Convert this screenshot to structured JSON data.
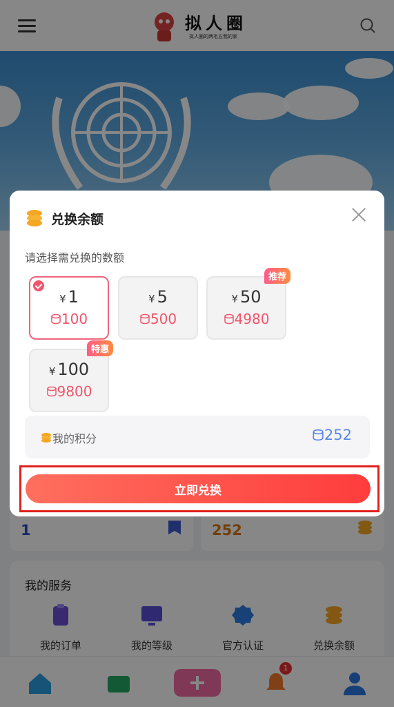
{
  "header": {
    "app_title": "拟人圈",
    "slogan": "拟人圈的两毛五我的家"
  },
  "modal": {
    "title": "兑换余额",
    "hint": "请选择需兑换的数额",
    "options": [
      {
        "price": "1",
        "points": "100",
        "tag": "",
        "selected": true
      },
      {
        "price": "5",
        "points": "500",
        "tag": ""
      },
      {
        "price": "50",
        "points": "4980",
        "tag": "推荐"
      },
      {
        "price": "100",
        "points": "9800",
        "tag": "特惠"
      }
    ],
    "currency_symbol": "¥",
    "my_points_label": "我的积分",
    "my_points_value": "252",
    "exchange_button": "立即兑换"
  },
  "stats": {
    "balance": "1",
    "points": "252"
  },
  "services": {
    "title": "我的服务",
    "items": [
      {
        "label": "我的订单",
        "icon": "clipboard-icon"
      },
      {
        "label": "我的等级",
        "icon": "chart-icon"
      },
      {
        "label": "官方认证",
        "icon": "verified-icon"
      },
      {
        "label": "兑换余额",
        "icon": "coins-icon"
      }
    ]
  },
  "tabbar": {
    "notification_badge": "1"
  },
  "colors": {
    "accent": "#f0556c",
    "button": "#ff4a44",
    "points_blue": "#5a86e6",
    "highlight_box": "#e0201c"
  }
}
